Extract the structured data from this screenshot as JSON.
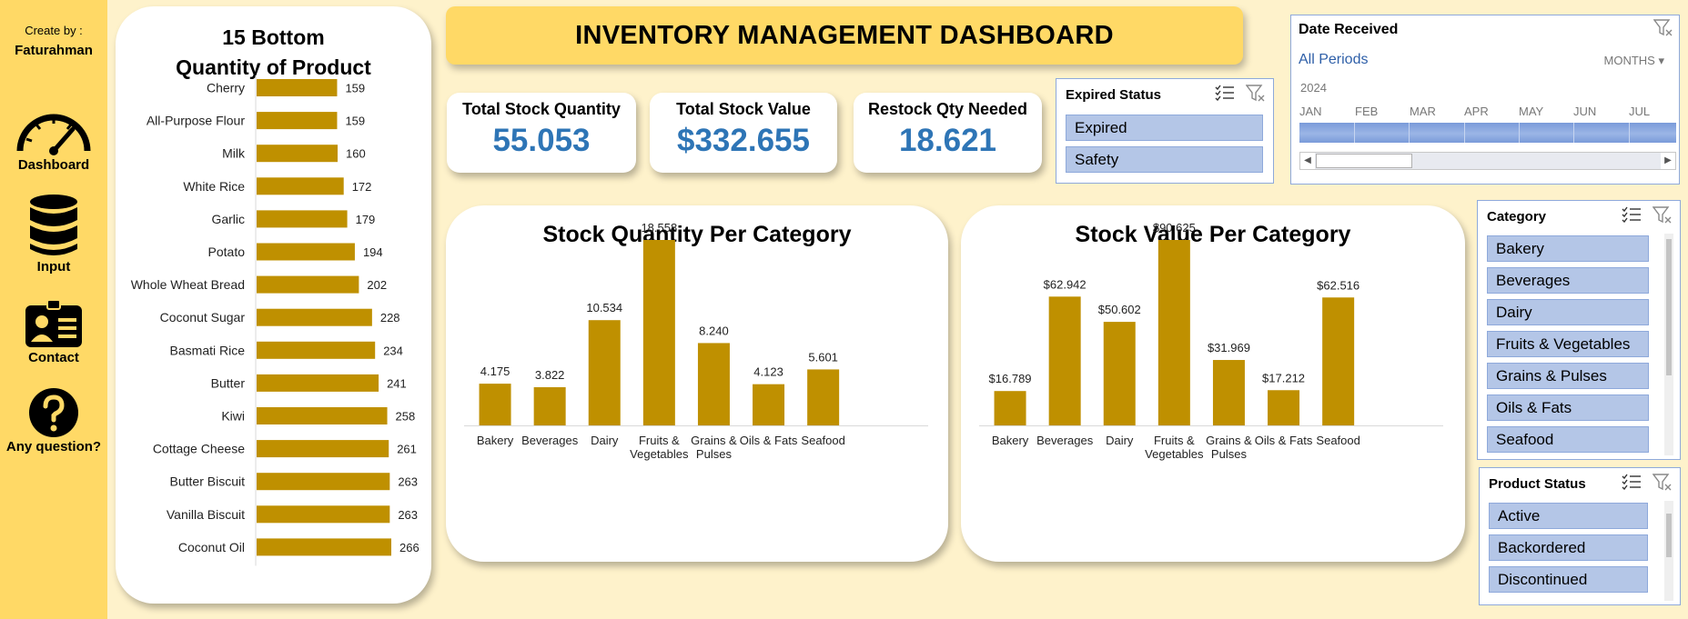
{
  "sidebar": {
    "created_label": "Create by :",
    "author": "Faturahman",
    "items": [
      {
        "label": "Dashboard",
        "icon": "speedometer-icon"
      },
      {
        "label": "Input",
        "icon": "database-icon"
      },
      {
        "label": "Contact",
        "icon": "id-card-icon"
      },
      {
        "label": "Any question?",
        "icon": "question-icon"
      }
    ]
  },
  "header": {
    "title": "INVENTORY MANAGEMENT DASHBOARD"
  },
  "kpis": [
    {
      "label": "Total Stock Quantity",
      "value": "55.053"
    },
    {
      "label": "Total Stock Value",
      "value": "$332.655"
    },
    {
      "label": "Restock Qty Needed",
      "value": "18.621"
    }
  ],
  "expired_slicer": {
    "title": "Expired Status",
    "items": [
      "Expired",
      "Safety"
    ]
  },
  "date_timeline": {
    "title": "Date Received",
    "selection": "All Periods",
    "unit": "MONTHS",
    "year": "2024",
    "months": [
      "JAN",
      "FEB",
      "MAR",
      "APR",
      "MAY",
      "JUN",
      "JUL"
    ]
  },
  "category_slicer": {
    "title": "Category",
    "items": [
      "Bakery",
      "Beverages",
      "Dairy",
      "Fruits & Vegetables",
      "Grains & Pulses",
      "Oils & Fats",
      "Seafood"
    ]
  },
  "product_status_slicer": {
    "title": "Product Status",
    "items": [
      "Active",
      "Backordered",
      "Discontinued"
    ]
  },
  "colors": {
    "bar": "#BF9000",
    "accent": "#2E75B6",
    "header": "#FFD966",
    "slicer_item": "#B4C6E7"
  },
  "chart_data": [
    {
      "type": "bar",
      "orientation": "horizontal",
      "title_line1": "15 Bottom",
      "title_line2": "Quantity of Product",
      "categories": [
        "Cherry",
        "All-Purpose Flour",
        "Milk",
        "White Rice",
        "Garlic",
        "Potato",
        "Whole Wheat Bread",
        "Coconut Sugar",
        "Basmati Rice",
        "Butter",
        "Kiwi",
        "Cottage Cheese",
        "Butter Biscuit",
        "Vanilla Biscuit",
        "Coconut Oil"
      ],
      "values": [
        159,
        159,
        160,
        172,
        179,
        194,
        202,
        228,
        234,
        241,
        258,
        261,
        263,
        263,
        266
      ],
      "value_labels": [
        "159",
        "159",
        "160",
        "172",
        "179",
        "194",
        "202",
        "228",
        "234",
        "241",
        "258",
        "261",
        "263",
        "263",
        "266"
      ],
      "xlim": [
        0,
        300
      ]
    },
    {
      "type": "bar",
      "title": "Stock Quantity Per Category",
      "categories": [
        [
          "Bakery"
        ],
        [
          "Beverages"
        ],
        [
          "Dairy"
        ],
        [
          "Fruits &",
          "Vegetables"
        ],
        [
          "Grains &",
          "Pulses"
        ],
        [
          "Oils & Fats"
        ],
        [
          "Seafood"
        ]
      ],
      "values": [
        4175,
        3822,
        10534,
        18558,
        8240,
        4123,
        5601
      ],
      "value_labels": [
        "4.175",
        "3.822",
        "10.534",
        "18.558",
        "8.240",
        "4.123",
        "5.601"
      ],
      "ylim": [
        0,
        18558
      ]
    },
    {
      "type": "bar",
      "title": "Stock Value Per Category",
      "categories": [
        [
          "Bakery"
        ],
        [
          "Beverages"
        ],
        [
          "Dairy"
        ],
        [
          "Fruits &",
          "Vegetables"
        ],
        [
          "Grains &",
          "Pulses"
        ],
        [
          "Oils & Fats"
        ],
        [
          "Seafood"
        ]
      ],
      "values": [
        16789,
        62942,
        50602,
        90625,
        31969,
        17212,
        62516
      ],
      "value_labels": [
        "$16.789",
        "$62.942",
        "$50.602",
        "$90.625",
        "$31.969",
        "$17.212",
        "$62.516"
      ],
      "ylim": [
        0,
        90625
      ]
    }
  ]
}
